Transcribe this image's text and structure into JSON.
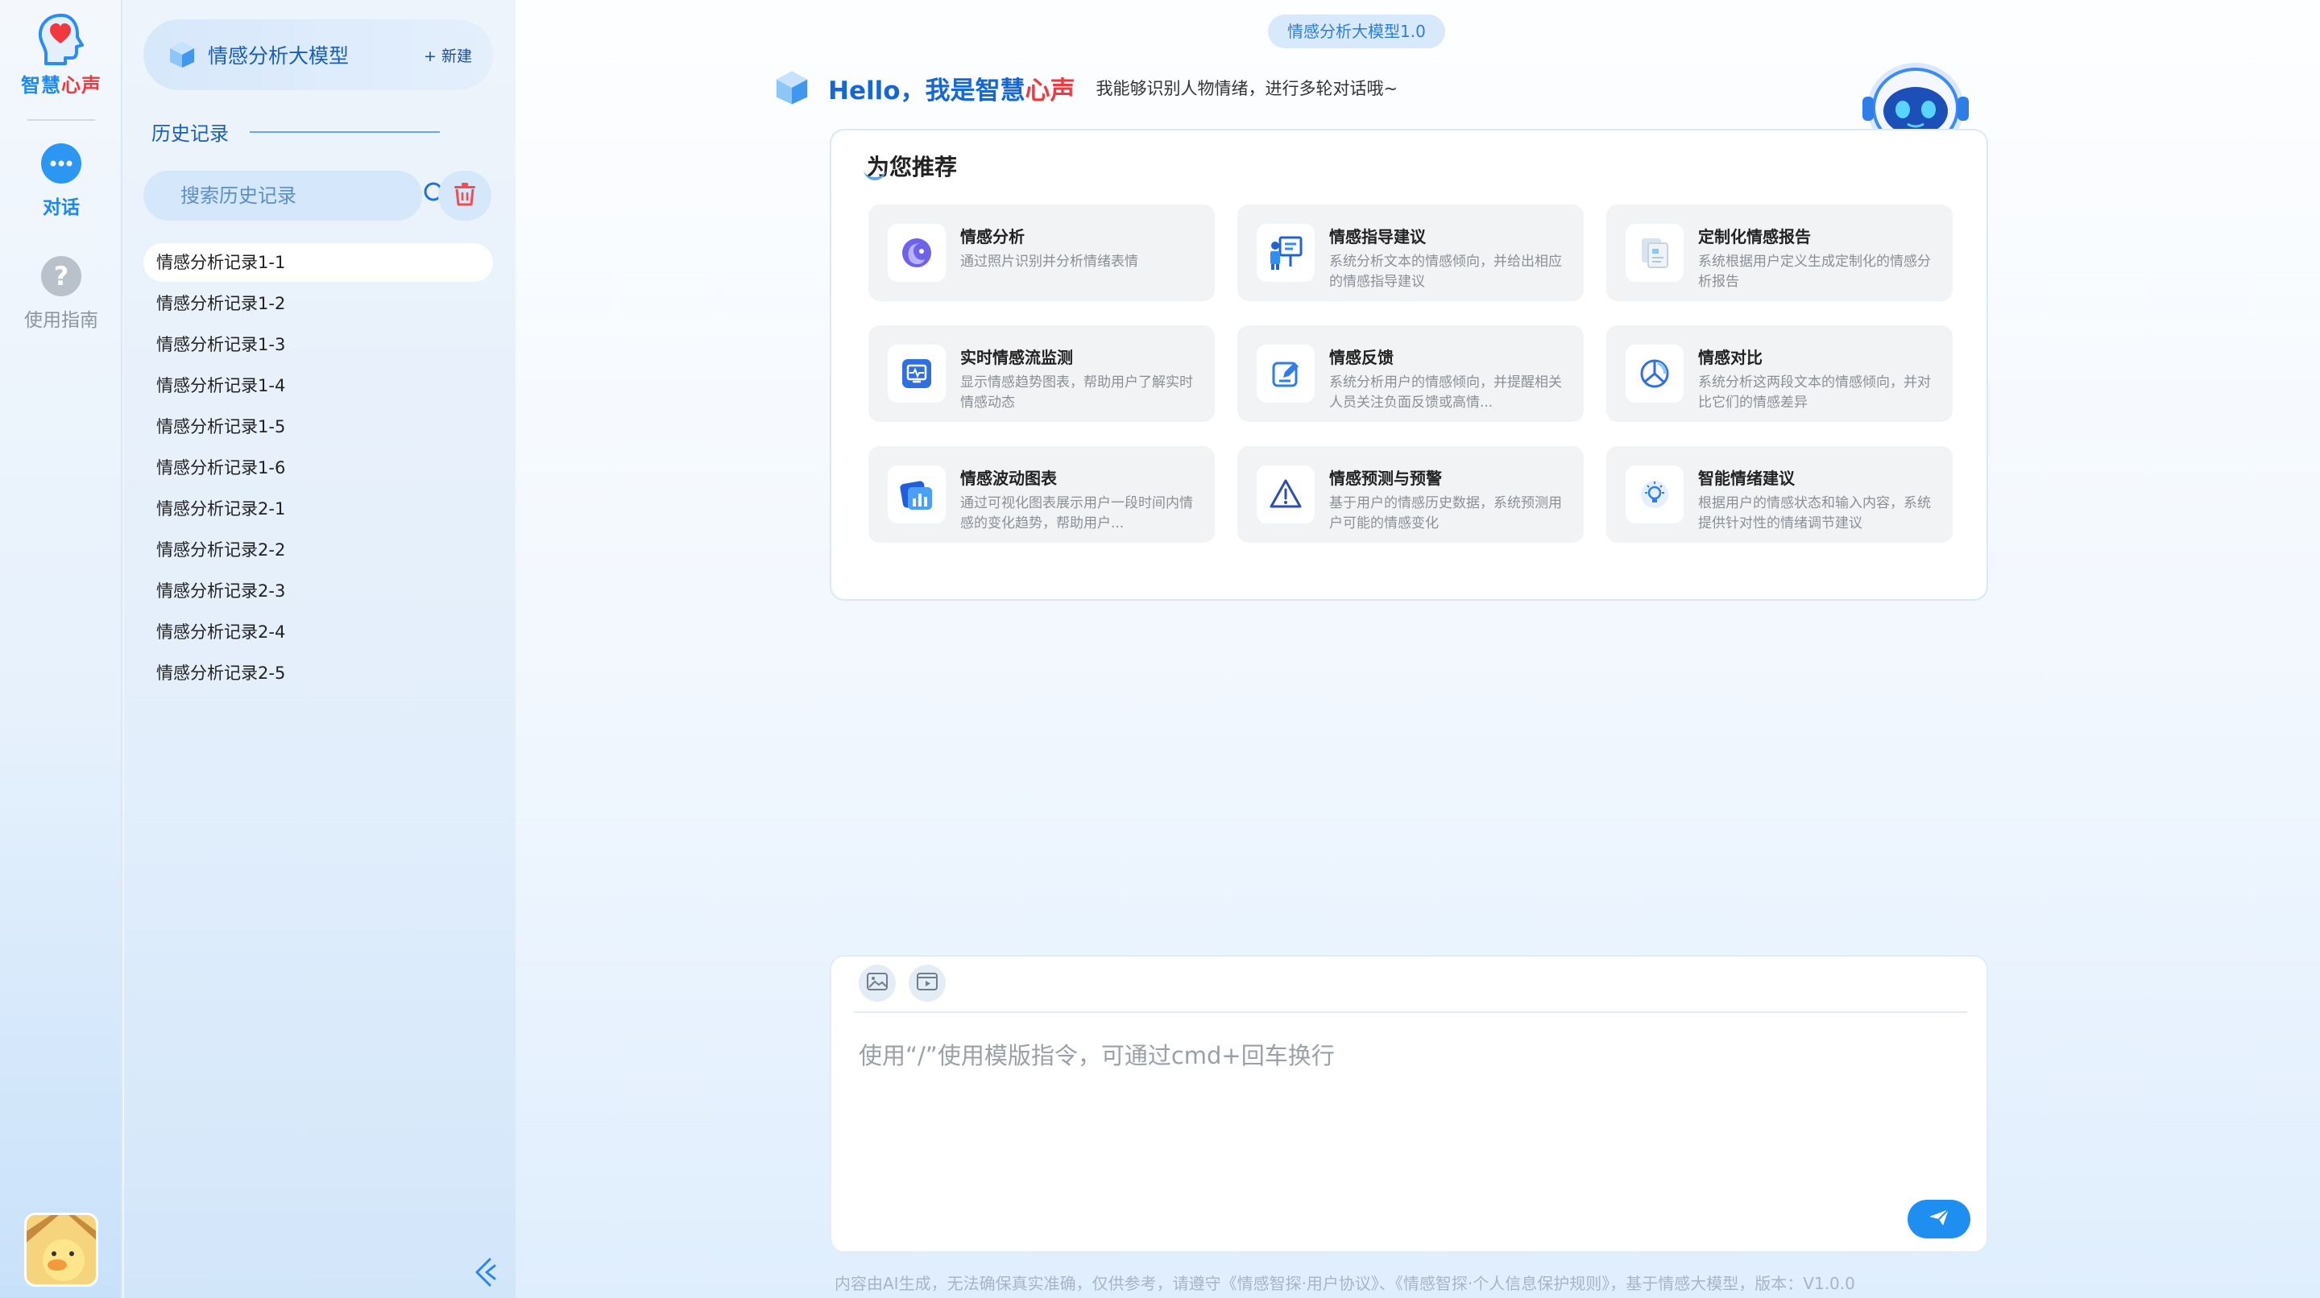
{
  "app": {
    "brand_part1": "智慧",
    "brand_part2": "心声",
    "accent_color": "#1d8af0",
    "brand_red": "#f0393f"
  },
  "rail": {
    "nav": [
      {
        "label": "对话",
        "icon": "chat-bubble-icon",
        "active": true
      },
      {
        "label": "使用指南",
        "icon": "question-mark-icon",
        "active": false
      }
    ],
    "avatar_icon": "duck-avatar-icon"
  },
  "sidebar": {
    "model_name": "情感分析大模型",
    "new_label": "+ 新建",
    "history_title": "历史记录",
    "search_placeholder": "搜索历史记录",
    "history": [
      "情感分析记录1-1",
      "情感分析记录1-2",
      "情感分析记录1-3",
      "情感分析记录1-4",
      "情感分析记录1-5",
      "情感分析记录1-6",
      "情感分析记录2-1",
      "情感分析记录2-2",
      "情感分析记录2-3",
      "情感分析记录2-4",
      "情感分析记录2-5"
    ]
  },
  "header": {
    "model_version": "情感分析大模型1.0",
    "hello_prefix": "Hello，我是",
    "hello_name1": "智慧",
    "hello_name2": "心声",
    "hello_sub": "我能够识别人物情绪，进行多轮对话哦~"
  },
  "recommend": {
    "title": "为您推荐",
    "cards": [
      {
        "title": "情感分析",
        "desc": "通过照片识别并分析情绪表情",
        "icon": "face-profile-icon"
      },
      {
        "title": "情感指导建议",
        "desc": "系统分析文本的情感倾向，并给出相应的情感指导建议",
        "icon": "teacher-board-icon"
      },
      {
        "title": "定制化情感报告",
        "desc": "系统根据用户定义生成定制化的情感分析报告",
        "icon": "report-document-icon"
      },
      {
        "title": "实时情感流监测",
        "desc": "显示情感趋势图表，帮助用户了解实时情感动态",
        "icon": "monitor-pulse-icon"
      },
      {
        "title": "情感反馈",
        "desc": "系统分析用户的情感倾向，并提醒相关人员关注负面反馈或高情...",
        "icon": "edit-feedback-icon"
      },
      {
        "title": "情感对比",
        "desc": "系统分析这两段文本的情感倾向，并对比它们的情感差异",
        "icon": "pie-compare-icon"
      },
      {
        "title": "情感波动图表",
        "desc": "通过可视化图表展示用户一段时间内情感的变化趋势，帮助用户...",
        "icon": "bar-chart-icon"
      },
      {
        "title": "情感预测与预警",
        "desc": "基于用户的情感历史数据，系统预测用户可能的情感变化",
        "icon": "warning-triangle-icon"
      },
      {
        "title": "智能情绪建议",
        "desc": "根据用户的情感状态和输入内容，系统提供针对性的情绪调节建议",
        "icon": "lightbulb-icon"
      }
    ]
  },
  "composer": {
    "placeholder": "使用“/”使用模版指令，可通过cmd+回车换行",
    "tools": [
      "image-upload-icon",
      "video-upload-icon"
    ],
    "send_icon": "paper-plane-icon"
  },
  "footer": {
    "text": "内容由AI生成，无法确保真实准确，仅供参考，请遵守《情感智探·用户协议》、《情感智探·个人信息保护规则》，基于情感大模型，版本：V1.0.0"
  }
}
